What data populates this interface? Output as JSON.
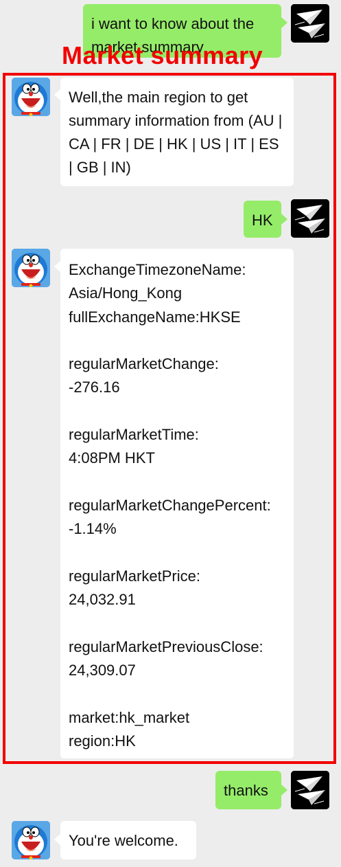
{
  "annotation": {
    "label": "Market summary",
    "color": "#f20000"
  },
  "colors": {
    "user_bubble": "#95ec69",
    "bot_bubble": "#ffffff",
    "background": "#ededed"
  },
  "messages": [
    {
      "sender": "user",
      "avatar_icon": "paper-planes-icon",
      "text": "i want to know about the market summary"
    },
    {
      "sender": "bot",
      "avatar_icon": "doraemon-icon",
      "text": "Well,the main region to get summary information from (AU | CA | FR | DE | HK | US | IT | ES | GB | IN)"
    },
    {
      "sender": "user",
      "avatar_icon": "paper-planes-icon",
      "text": "HK"
    },
    {
      "sender": "bot",
      "avatar_icon": "doraemon-icon",
      "text": "ExchangeTimezoneName:\nAsia/Hong_Kong\nfullExchangeName:HKSE\n\nregularMarketChange:\n-276.16\n\nregularMarketTime:\n4:08PM HKT\n\nregularMarketChangePercent:\n-1.14%\n\nregularMarketPrice:\n24,032.91\n\nregularMarketPreviousClose:\n24,309.07\n\nmarket:hk_market\nregion:HK"
    },
    {
      "sender": "user",
      "avatar_icon": "paper-planes-icon",
      "text": "thanks"
    },
    {
      "sender": "bot",
      "avatar_icon": "doraemon-icon",
      "text": "You're welcome."
    }
  ]
}
